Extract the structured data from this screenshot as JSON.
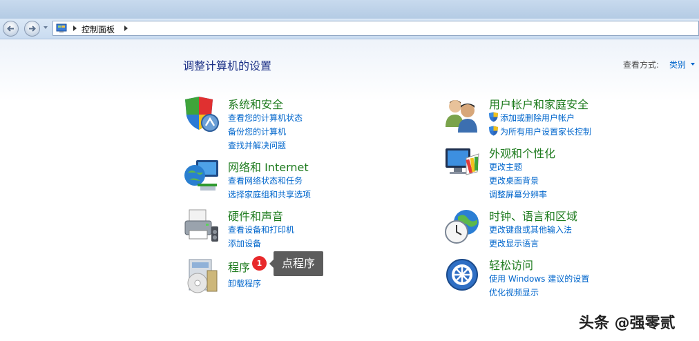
{
  "address": {
    "path_label": "控制面板"
  },
  "header": {
    "title": "调整计算机的设置",
    "view_by_label": "查看方式:",
    "view_by_value": "类别"
  },
  "categories": [
    {
      "title": "系统和安全",
      "icon": "shield-icon",
      "links": [
        "查看您的计算机状态",
        "备份您的计算机",
        "查找并解决问题"
      ]
    },
    {
      "title": "网络和 Internet",
      "icon": "network-icon",
      "links": [
        "查看网络状态和任务",
        "选择家庭组和共享选项"
      ]
    },
    {
      "title": "硬件和声音",
      "icon": "printer-icon",
      "links": [
        "查看设备和打印机",
        "添加设备"
      ]
    },
    {
      "title": "程序",
      "icon": "programs-icon",
      "links": [
        "卸载程序"
      ]
    },
    {
      "title": "用户帐户和家庭安全",
      "icon": "users-icon",
      "links": [
        "添加或删除用户帐户",
        "为所有用户设置家长控制"
      ]
    },
    {
      "title": "外观和个性化",
      "icon": "appearance-icon",
      "links": [
        "更改主题",
        "更改桌面背景",
        "调整屏幕分辨率"
      ]
    },
    {
      "title": "时钟、语言和区域",
      "icon": "clock-globe-icon",
      "links": [
        "更改键盘或其他输入法",
        "更改显示语言"
      ]
    },
    {
      "title": "轻松访问",
      "icon": "ease-of-access-icon",
      "links": [
        "使用 Windows 建议的设置",
        "优化视频显示"
      ]
    }
  ],
  "annotation": {
    "badge": "1",
    "tooltip": "点程序"
  },
  "watermark": "头条 @强零贰"
}
